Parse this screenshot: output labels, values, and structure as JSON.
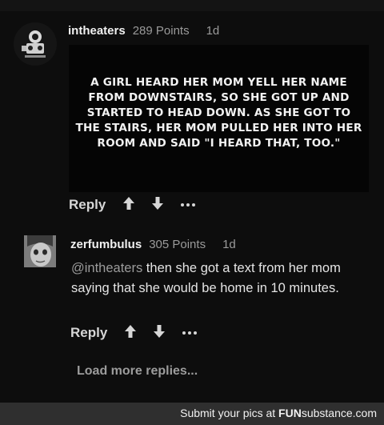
{
  "comment": {
    "username": "intheaters",
    "points": "289 Points",
    "age": "1d",
    "image_text": "A girl heard her mom yell her name from downstairs, so she got up and started to head down. As she got to the stairs, her mom pulled her into her room and said \"I heard that, too.\""
  },
  "reply": {
    "username": "zerfumbulus",
    "points": "305 Points",
    "age": "1d",
    "mention": "@intheaters",
    "body": " then she got a text from her mom saying that she would be home in 10 minutes."
  },
  "actions": {
    "reply_label": "Reply",
    "upvote_icon": "up-arrow-icon",
    "downvote_icon": "down-arrow-icon",
    "more_icon": "more-dots-icon"
  },
  "load_more_label": "Load more replies...",
  "footer": {
    "prefix": "Submit your pics at ",
    "brand_bold": "FUN",
    "brand_rest": "substance",
    "suffix": ".com"
  },
  "colors": {
    "background": "#0d0d0d",
    "footer_bg": "#2f2f2f",
    "muted_text": "#9a9a9a"
  }
}
